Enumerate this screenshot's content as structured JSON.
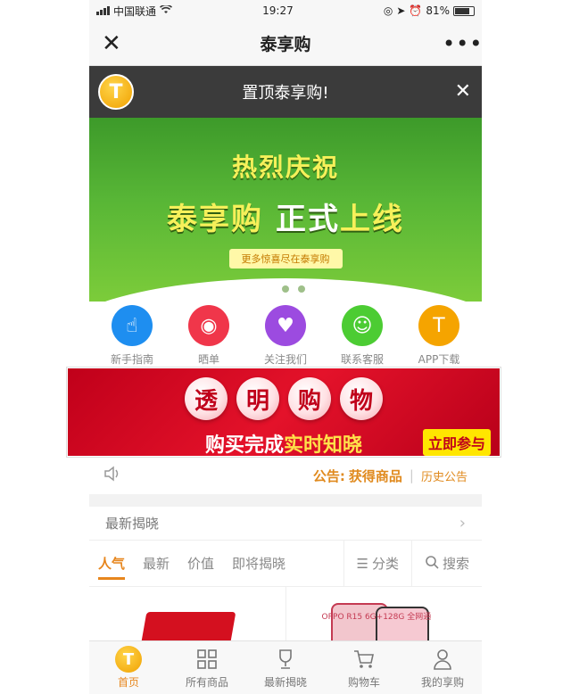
{
  "status": {
    "carrier": "中国联通",
    "time": "19:27",
    "battery": "81%",
    "battery_level": 0.81
  },
  "nav": {
    "title": "泰享购"
  },
  "pin_banner": {
    "text": "置顶泰享购!"
  },
  "hero": {
    "line1": "热烈庆祝",
    "line2_a": "泰享购",
    "line2_b": "正式",
    "line2_c": "上线",
    "tag": "更多惊喜尽在泰享购",
    "slides": 3,
    "active_slide": 0
  },
  "quick_links": [
    {
      "label": "新手指南",
      "icon": "hand-pointer-icon",
      "color": "#1e8ef0"
    },
    {
      "label": "晒单",
      "icon": "camera-icon",
      "color": "#f0364a"
    },
    {
      "label": "关注我们",
      "icon": "heart-icon",
      "color": "#9c4be0"
    },
    {
      "label": "联系客服",
      "icon": "chat-icon",
      "color": "#4ccc33"
    },
    {
      "label": "APP下载",
      "icon": "app-logo-icon",
      "color": "#f5a400"
    }
  ],
  "promo": {
    "chars": [
      "透",
      "明",
      "购",
      "物"
    ],
    "line_a": "购买完成",
    "line_b": "实时知晓",
    "join": "立即参与"
  },
  "notice": {
    "label": "公告:",
    "value": "获得商品",
    "history": "历史公告"
  },
  "latest": {
    "title": "最新揭晓"
  },
  "sort_tabs": [
    {
      "label": "人气",
      "active": true
    },
    {
      "label": "最新",
      "active": false
    },
    {
      "label": "价值",
      "active": false
    },
    {
      "label": "即将揭晓",
      "active": false
    }
  ],
  "tools": {
    "category": "分类",
    "search": "搜索"
  },
  "products": {
    "phone_label": "OPPO R15 6G+128G 全网通"
  },
  "tabbar": [
    {
      "label": "首页",
      "icon": "home-logo-icon",
      "active": true
    },
    {
      "label": "所有商品",
      "icon": "grid-icon",
      "active": false
    },
    {
      "label": "最新揭晓",
      "icon": "trophy-icon",
      "active": false
    },
    {
      "label": "购物车",
      "icon": "cart-icon",
      "active": false
    },
    {
      "label": "我的享购",
      "icon": "user-icon",
      "active": false
    }
  ],
  "colors": {
    "accent": "#e7861d",
    "hero_green": "#58b636",
    "promo_red": "#e4122a"
  }
}
